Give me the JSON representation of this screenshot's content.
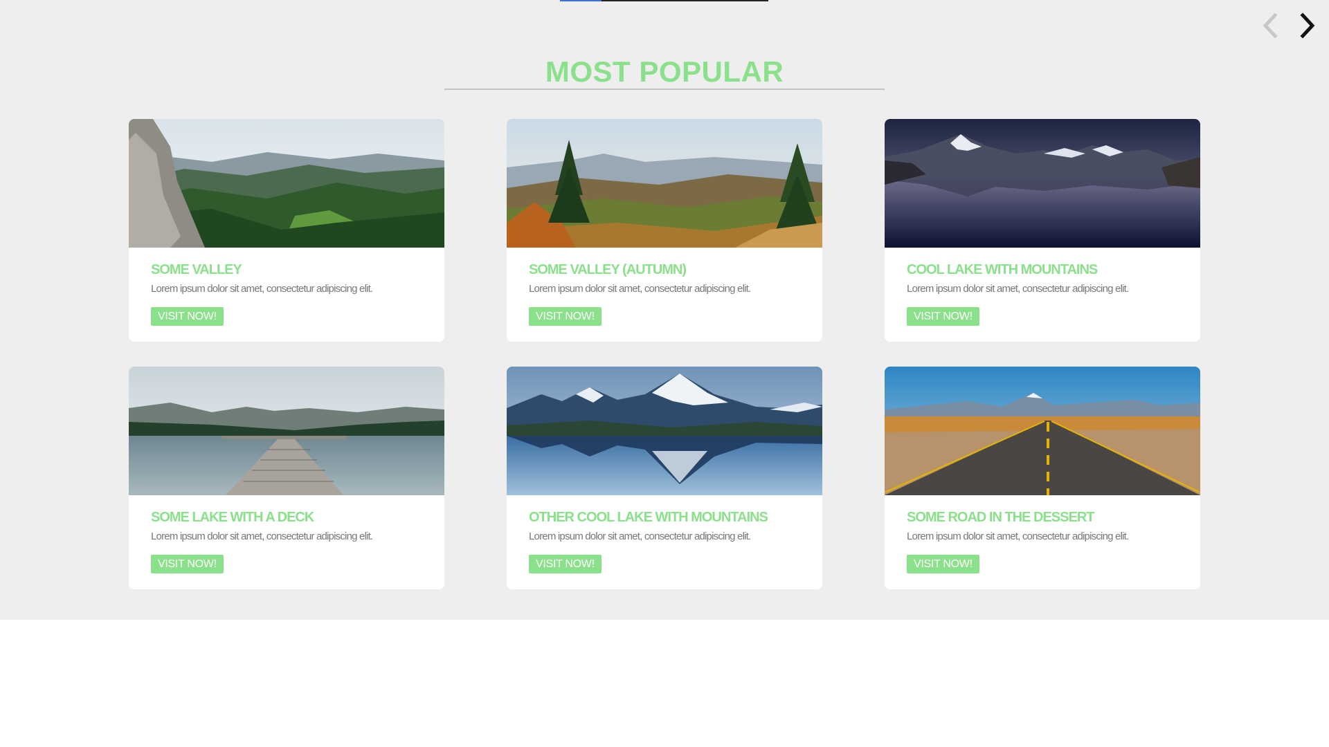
{
  "colors": {
    "accent": "#8be08b",
    "section_bg": "#eeeeee",
    "text_muted": "#777777",
    "progress_fill": "#3a6fd8"
  },
  "slider": {
    "progress": 0.2,
    "prev_icon": "chevron-left-icon",
    "next_icon": "chevron-right-icon"
  },
  "section": {
    "title": "MOST POPULAR"
  },
  "cards": [
    {
      "title": "SOME VALLEY",
      "description": "Lorem ipsum dolor sit amet, consectetur adipiscing elit.",
      "button_label": "VISIT NOW!",
      "image": "green-valley-photo"
    },
    {
      "title": "SOME VALLEY (AUTUMN)",
      "description": "Lorem ipsum dolor sit amet, consectetur adipiscing elit.",
      "button_label": "VISIT NOW!",
      "image": "autumn-valley-photo"
    },
    {
      "title": "COOL LAKE WITH MOUNTAINS",
      "description": "Lorem ipsum dolor sit amet, consectetur adipiscing elit.",
      "button_label": "VISIT NOW!",
      "image": "dusk-mountain-lake-photo"
    },
    {
      "title": "SOME LAKE WITH A DECK",
      "description": "Lorem ipsum dolor sit amet, consectetur adipiscing elit.",
      "button_label": "VISIT NOW!",
      "image": "lake-deck-photo"
    },
    {
      "title": "OTHER COOL LAKE WITH MOUNTAINS",
      "description": "Lorem ipsum dolor sit amet, consectetur adipiscing elit.",
      "button_label": "VISIT NOW!",
      "image": "snowy-mountain-reflection-photo"
    },
    {
      "title": "SOME ROAD IN THE DESSERT",
      "description": "Lorem ipsum dolor sit amet, consectetur adipiscing elit.",
      "button_label": "VISIT NOW!",
      "image": "desert-road-photo"
    }
  ]
}
